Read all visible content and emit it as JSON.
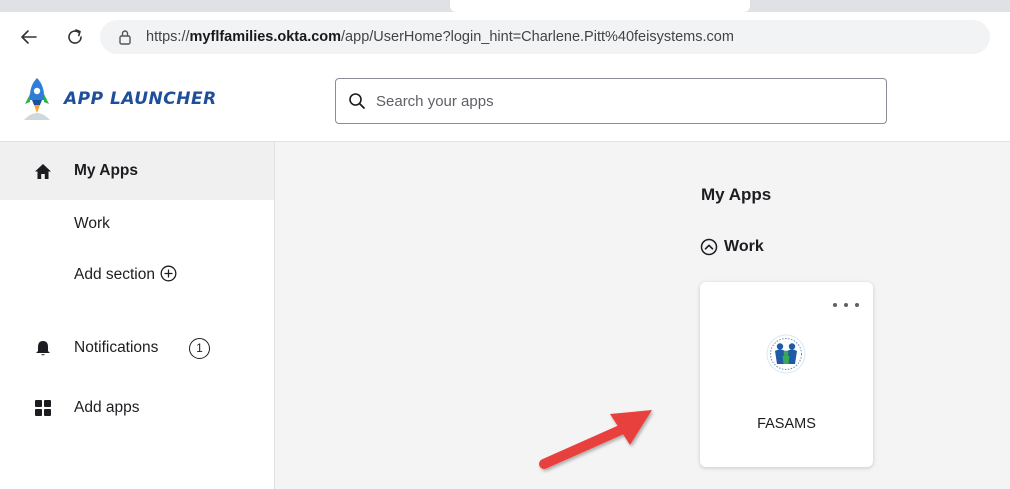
{
  "browser": {
    "url_prefix": "https://",
    "url_domain": "myflfamilies.okta.com",
    "url_path": "/app/UserHome?login_hint=Charlene.Pitt%40feisystems.com"
  },
  "header": {
    "logo_text": "APP LAUNCHER",
    "search_placeholder": "Search your apps"
  },
  "sidebar": {
    "my_apps": "My Apps",
    "work": "Work",
    "add_section": "Add section",
    "notifications": "Notifications",
    "notifications_count": "1",
    "add_apps": "Add apps"
  },
  "main": {
    "title": "My Apps",
    "section_label": "Work",
    "tiles": [
      {
        "label": "FASAMS"
      }
    ]
  },
  "colors": {
    "logo_blue": "#1f4e9b",
    "arrow_red": "#e8413d",
    "active_nav_bg": "#f0f0f0"
  }
}
